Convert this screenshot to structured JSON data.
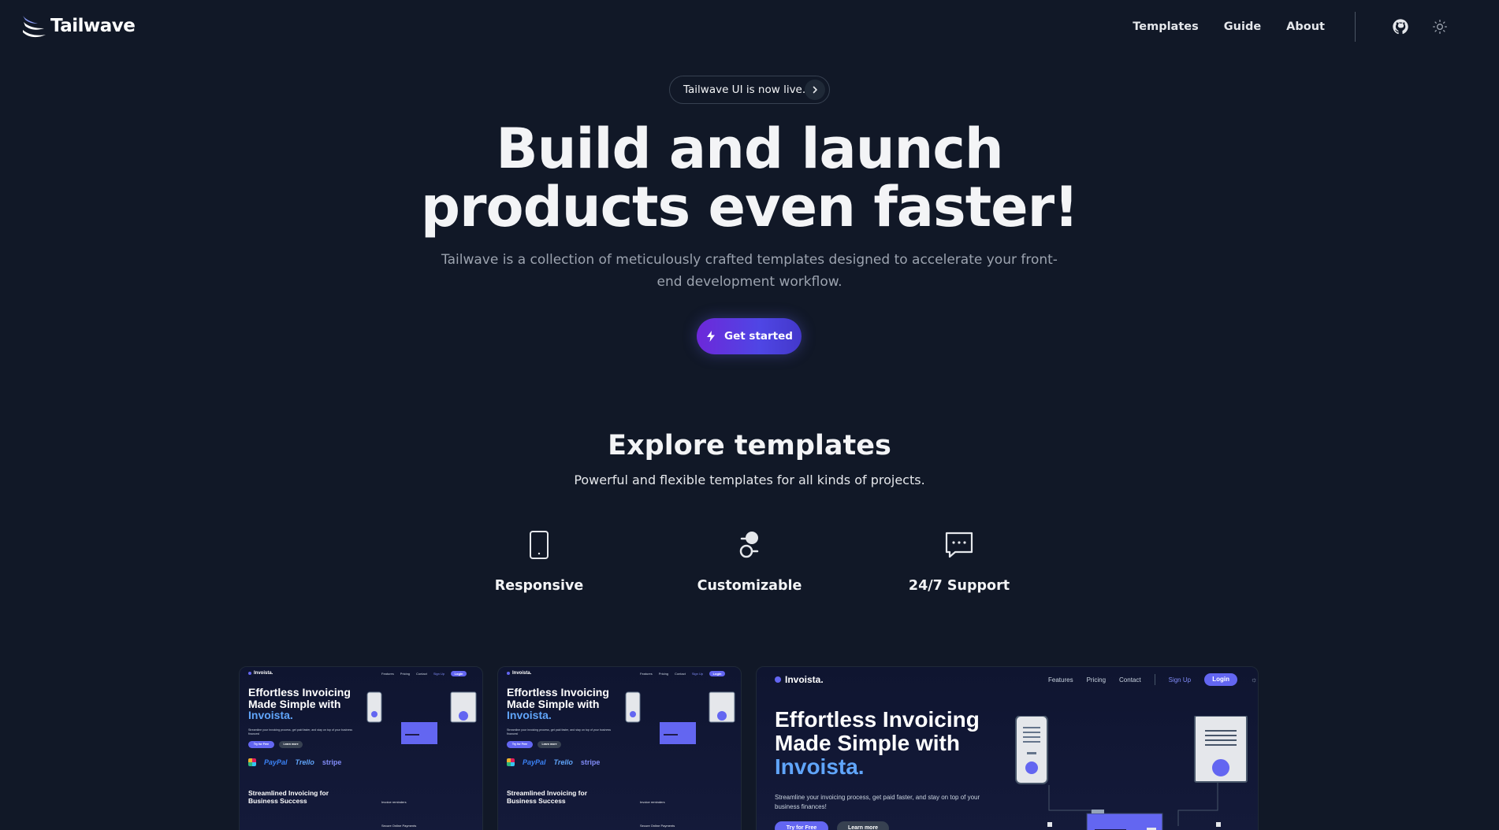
{
  "brand": {
    "name": "Tailwave",
    "color": "#ffffff"
  },
  "nav": {
    "links": [
      "Templates",
      "Guide",
      "About"
    ],
    "github_icon": "github-icon",
    "theme_icon": "sun-icon"
  },
  "hero": {
    "announcement": "Tailwave UI is now live.",
    "title_line1": "Build and launch",
    "title_line2": "products even faster!",
    "subtitle": "Tailwave is a collection of meticulously crafted templates designed to accelerate your front-end development workflow.",
    "cta_label": "Get started",
    "cta_icon": "bolt-icon",
    "accent": "#4f46e5"
  },
  "explore": {
    "title": "Explore templates",
    "subtitle": "Powerful and flexible templates for all kinds of projects.",
    "features": [
      {
        "label": "Responsive",
        "icon": "phone-icon"
      },
      {
        "label": "Customizable",
        "icon": "toggle-icon"
      },
      {
        "label": "24/7 Support",
        "icon": "chat-icon"
      }
    ]
  },
  "previews": {
    "brand": "Invoista.",
    "nav_links": [
      "Features",
      "Pricing",
      "Contact"
    ],
    "signup": "Sign Up",
    "login": "Login",
    "headline_1": "Effortless Invoicing",
    "headline_2": "Made Simple with",
    "headline_accent": "Invoista.",
    "tagline": "Streamline your invoicing process, get paid faster, and stay on top of your business finances!",
    "try_free": "Try for Free",
    "learn_more": "Learn more",
    "logos": [
      "PayPal",
      "Trello",
      "stripe"
    ],
    "section_title_1": "Streamlined Invoicing for",
    "section_title_2": "Business Success",
    "list_items": [
      "Invoice reminders",
      "Secure Online Payments"
    ]
  }
}
